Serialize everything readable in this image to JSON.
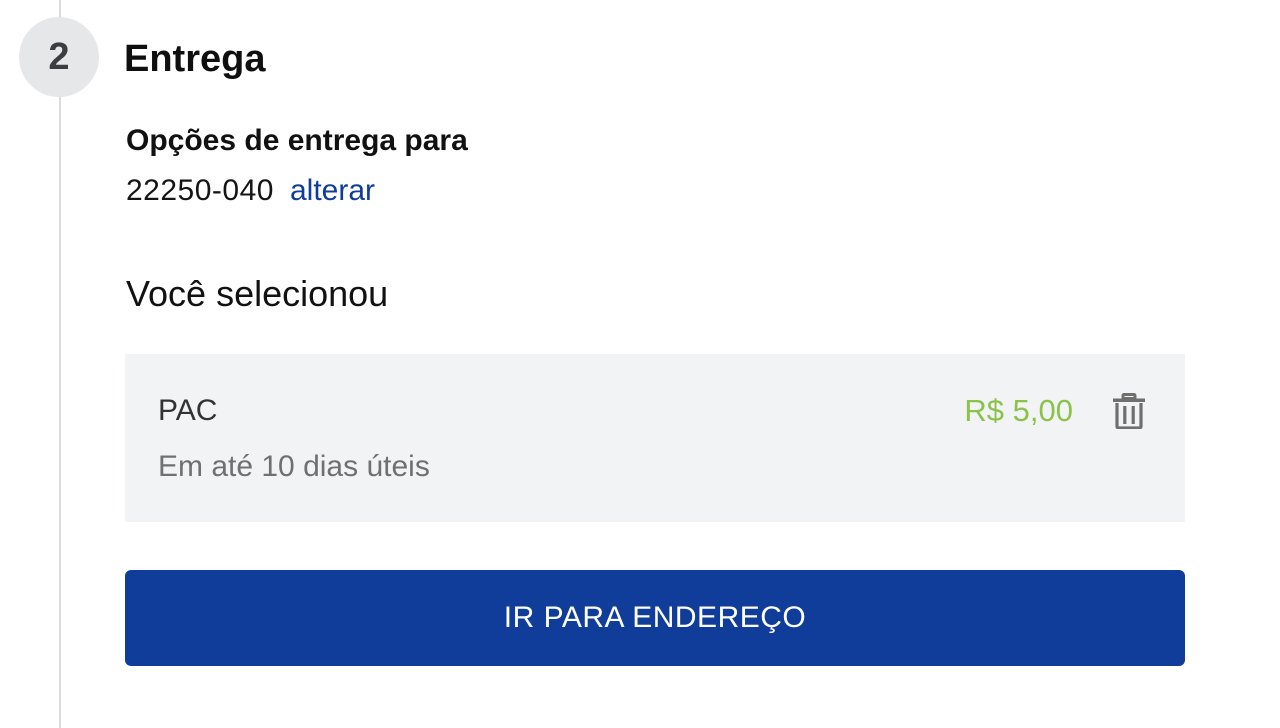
{
  "step": {
    "number": "2",
    "title": "Entrega"
  },
  "delivery": {
    "options_heading": "Opções de entrega para",
    "zip_code": "22250-040",
    "change_link": "alterar"
  },
  "selection": {
    "heading": "Você selecionou",
    "option": {
      "name": "PAC",
      "eta": "Em até 10 dias úteis",
      "price": "R$ 5,00",
      "remove_icon": "trash-icon"
    }
  },
  "actions": {
    "go_to_address": "IR PARA ENDEREÇO"
  },
  "colors": {
    "primary": "#0f3d99",
    "price_green": "#8bc34a",
    "card_bg": "#f2f3f5",
    "badge_bg": "#e6e7e9"
  }
}
